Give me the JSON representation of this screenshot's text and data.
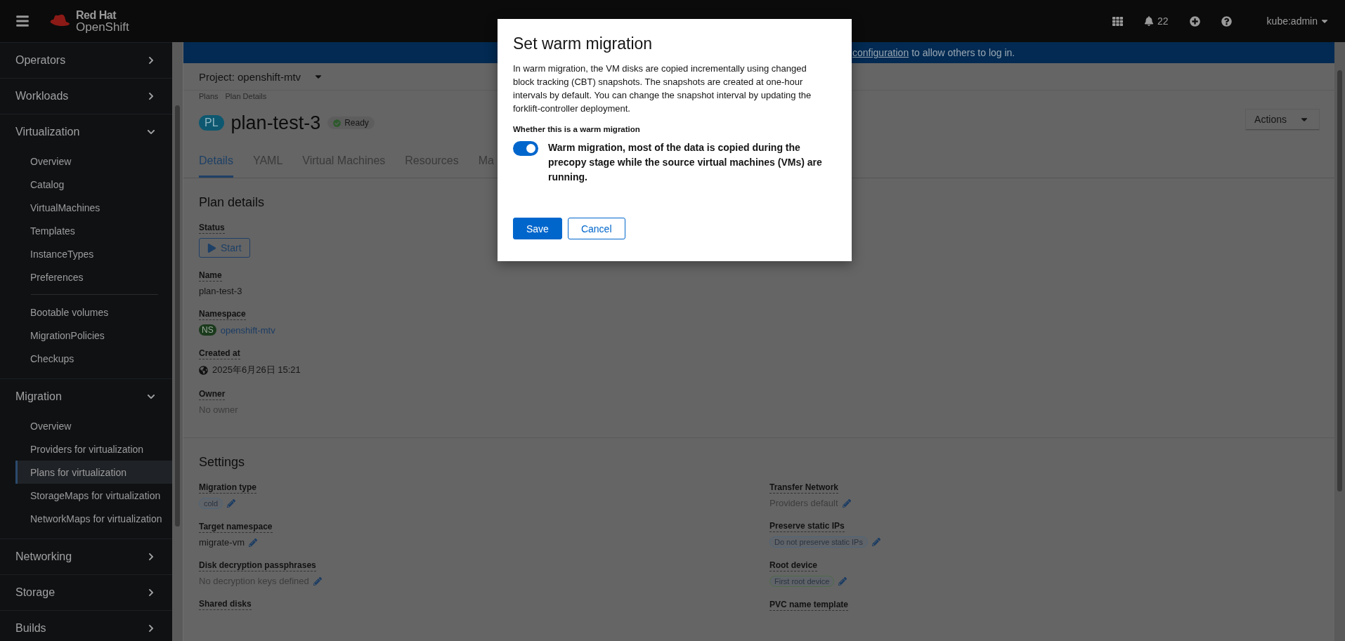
{
  "masthead": {
    "brand_line1": "Red Hat",
    "brand_line2": "OpenShift",
    "notifications": "22",
    "user": "kube:admin"
  },
  "sidebar": {
    "items": [
      {
        "label": "Operators",
        "expanded": false
      },
      {
        "label": "Workloads",
        "expanded": false
      },
      {
        "label": "Virtualization",
        "expanded": true,
        "sections": [
          [
            {
              "label": "Overview",
              "selected": false
            },
            {
              "label": "Catalog",
              "selected": false
            },
            {
              "label": "VirtualMachines",
              "selected": false
            },
            {
              "label": "Templates",
              "selected": false
            },
            {
              "label": "InstanceTypes",
              "selected": false
            },
            {
              "label": "Preferences",
              "selected": false
            }
          ],
          [
            {
              "label": "Bootable volumes",
              "selected": false
            },
            {
              "label": "MigrationPolicies",
              "selected": false
            },
            {
              "label": "Checkups",
              "selected": false
            }
          ]
        ]
      },
      {
        "label": "Migration",
        "expanded": true,
        "sections": [
          [
            {
              "label": "Overview",
              "selected": false
            },
            {
              "label": "Providers for virtualization",
              "selected": false
            },
            {
              "label": "Plans for virtualization",
              "selected": true
            },
            {
              "label": "StorageMaps for virtualization",
              "selected": false
            },
            {
              "label": "NetworkMaps for virtualization",
              "selected": false
            }
          ]
        ]
      },
      {
        "label": "Networking",
        "expanded": false
      },
      {
        "label": "Storage",
        "expanded": false
      },
      {
        "label": "Builds",
        "expanded": false
      }
    ]
  },
  "banner": {
    "link": "configuration",
    "text": "to allow others to log in."
  },
  "project": {
    "label": "Project: openshift-mtv"
  },
  "breadcrumb": [
    "Plans",
    "Plan Details"
  ],
  "header": {
    "badge": "PL",
    "title": "plan-test-3",
    "status": "Ready",
    "actions": "Actions"
  },
  "tabs": [
    {
      "label": "Details",
      "selected": true
    },
    {
      "label": "YAML",
      "selected": false
    },
    {
      "label": "Virtual Machines",
      "selected": false
    },
    {
      "label": "Resources",
      "selected": false
    },
    {
      "label": "Ma",
      "selected": false
    }
  ],
  "plan_details": {
    "heading": "Plan details",
    "fields": [
      {
        "kind": "button",
        "label": "Status",
        "value": "Start"
      },
      {
        "kind": "text",
        "label": "Name",
        "value": "plan-test-3"
      },
      {
        "kind": "namespace",
        "label": "Namespace",
        "badge": "NS",
        "value": "openshift-mtv"
      },
      {
        "kind": "timestamp",
        "label": "Created at",
        "value": "2025年6月26日 15:21"
      },
      {
        "kind": "muted",
        "label": "Owner",
        "value": "No owner"
      }
    ]
  },
  "settings": {
    "heading": "Settings",
    "left": [
      {
        "kind": "chip",
        "label": "Migration type",
        "value": "cold",
        "color": "#4f6479",
        "editable": true
      },
      {
        "kind": "text",
        "label": "Target namespace",
        "value": "migrate-vm",
        "editable": true
      },
      {
        "kind": "muted",
        "label": "Disk decryption passphrases",
        "value": "No decryption keys defined",
        "editable": true
      },
      {
        "label": "Shared disks"
      }
    ],
    "right": [
      {
        "kind": "muted",
        "label": "Transfer Network",
        "value": "Providers default",
        "editable": true
      },
      {
        "kind": "chip",
        "label": "Preserve static IPs",
        "value": "Do not preserve static IPs",
        "color": "#4f6479",
        "editable": true
      },
      {
        "kind": "chip",
        "label": "Root device",
        "value": "First root device",
        "color": "#4e6a48",
        "editable": true
      },
      {
        "label": "PVC name template"
      }
    ]
  },
  "modal": {
    "title": "Set warm migration",
    "description": "In warm migration, the VM disks are copied incrementally using changed block tracking (CBT) snapshots. The snapshots are created at one-hour intervals by default. You can change the snapshot interval by updating the forklift-controller deployment.",
    "group_label": "Whether this is a warm migration",
    "toggle": {
      "on": true,
      "label": "Warm migration, most of the data is copied during the precopy stage while the source virtual machines (VMs) are running."
    },
    "buttons": [
      {
        "label": "Save",
        "kind": "primary"
      },
      {
        "label": "Cancel",
        "kind": "secondary"
      }
    ]
  }
}
